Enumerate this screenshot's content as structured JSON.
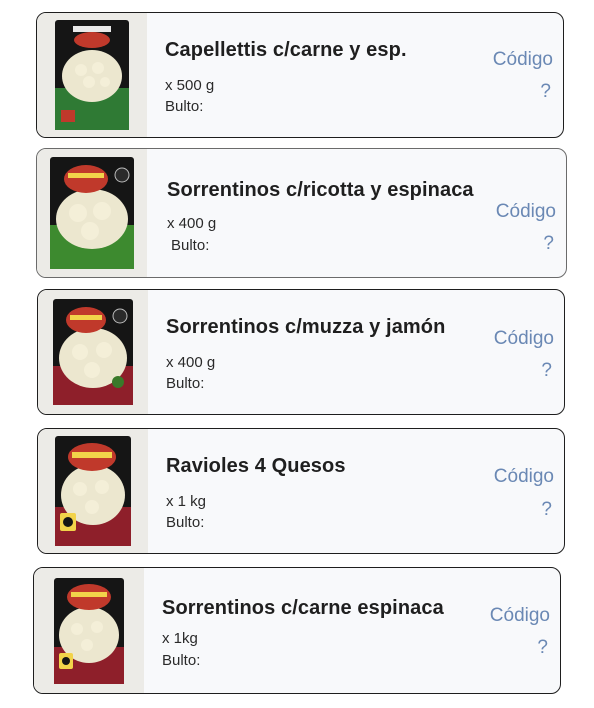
{
  "products": [
    {
      "title": "Capellettis c/carne y esp.",
      "weight": "x 500 g",
      "bulto_label": "Bulto:",
      "code_label": "Código",
      "code_value": "?",
      "package_colors": {
        "top": "#161616",
        "bottom": "#2f7a34",
        "accent": "#c0392b"
      }
    },
    {
      "title": "Sorrentinos c/ricotta y espinaca",
      "weight": "x 400 g",
      "bulto_label": "Bulto:",
      "code_label": "Código",
      "code_value": "?",
      "package_colors": {
        "top": "#161616",
        "bottom": "#3d8a2f",
        "accent": "#c0392b"
      }
    },
    {
      "title": "Sorrentinos c/muzza y jamón",
      "weight": "x 400 g",
      "bulto_label": "Bulto:",
      "code_label": "Código",
      "code_value": "?",
      "package_colors": {
        "top": "#161616",
        "bottom": "#8e1f2a",
        "accent": "#c0392b"
      }
    },
    {
      "title": "Ravioles 4 Quesos",
      "weight": "x 1 kg",
      "bulto_label": "Bulto:",
      "code_label": "Código",
      "code_value": "?",
      "package_colors": {
        "top": "#161616",
        "bottom": "#8e1f2a",
        "accent": "#c0392b"
      }
    },
    {
      "title": "Sorrentinos c/carne  espinaca",
      "weight": "x 1kg",
      "bulto_label": "Bulto:",
      "code_label": "Código",
      "code_value": "?",
      "package_colors": {
        "top": "#161616",
        "bottom": "#8e1f2a",
        "accent": "#c0392b"
      }
    }
  ],
  "theme": {
    "card_background": "#f8f9fb",
    "link_color": "#6a88b4",
    "text_color": "#1f1f1f"
  }
}
